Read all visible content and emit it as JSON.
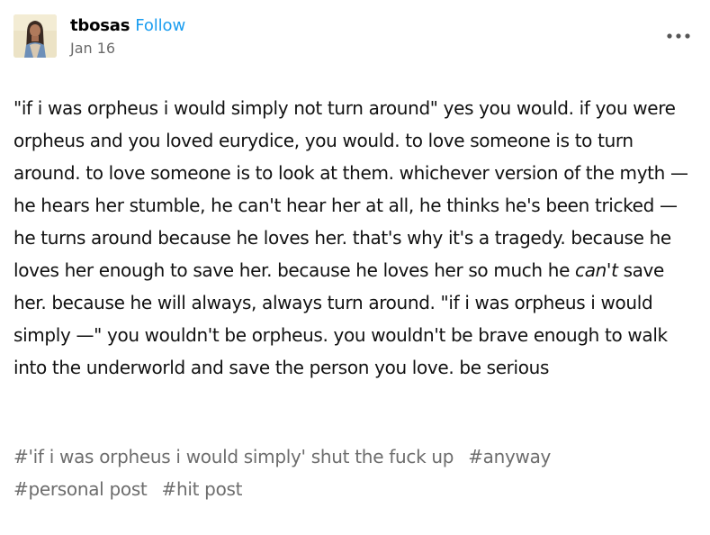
{
  "post": {
    "author": "tbosas",
    "follow_label": "Follow",
    "date": "Jan 16",
    "more_icon": "more-horizontal-icon",
    "body": {
      "part1": "\"if i was orpheus i would simply not turn around\" yes you would. if you were orpheus and you loved eurydice, you would. to love someone is to turn around. to love someone is to look at them. whichever version of the myth — he hears her stumble, he can't hear her at all, he thinks he's been tricked — he turns around because he loves her. that's why it's a tragedy. because he loves her enough to save her. because he loves her so much he ",
      "emphasis": "can't",
      "part2": " save her. because he will always, always turn around. \"if i was orpheus i would simply —\" you wouldn't be orpheus. you wouldn't be brave enough to walk into the underworld and save the person you love. be serious"
    },
    "tags": [
      "#'if i was orpheus i would simply' shut the fuck up",
      "#anyway",
      "#personal post",
      "#hit post"
    ]
  },
  "colors": {
    "follow": "#1a9df0",
    "tag_text": "#6d6d6d",
    "date_text": "#6b6b6b"
  }
}
